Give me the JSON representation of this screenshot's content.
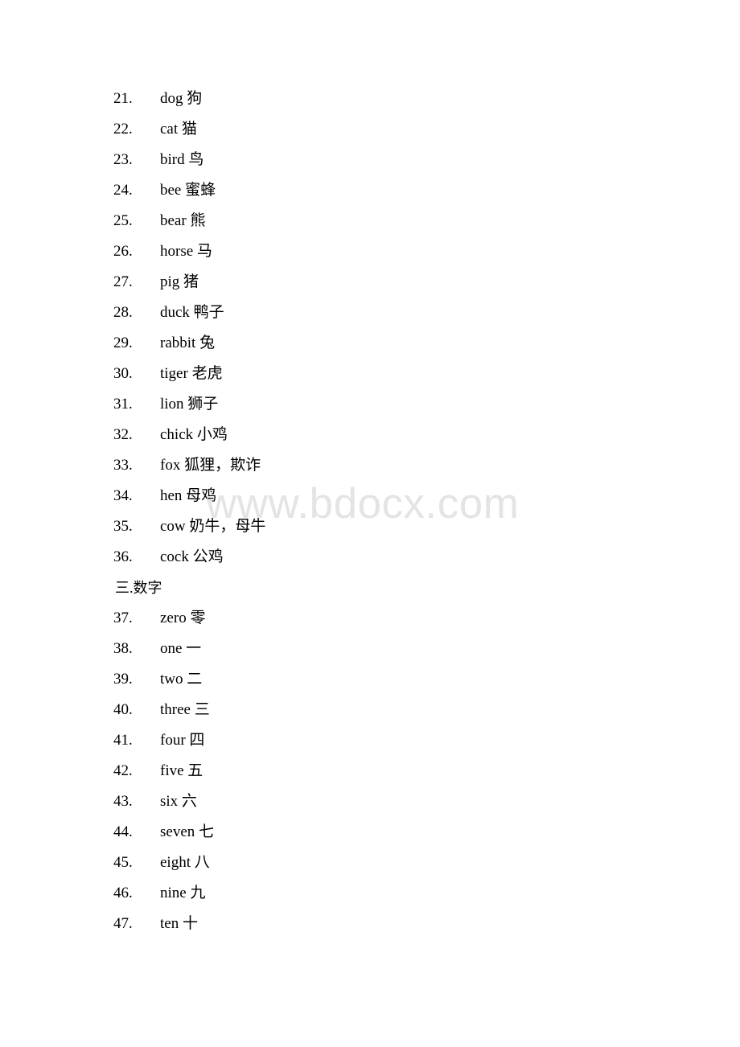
{
  "document": {
    "watermark": "www.bdocx.com",
    "blocks": [
      {
        "type": "item",
        "index": "21.",
        "term": "dog 狗"
      },
      {
        "type": "item",
        "index": "22.",
        "term": "cat 猫"
      },
      {
        "type": "item",
        "index": "23.",
        "term": "bird 鸟"
      },
      {
        "type": "item",
        "index": "24.",
        "term": "bee 蜜蜂"
      },
      {
        "type": "item",
        "index": "25.",
        "term": "bear 熊"
      },
      {
        "type": "item",
        "index": "26.",
        "term": "horse 马"
      },
      {
        "type": "item",
        "index": "27.",
        "term": "pig 猪"
      },
      {
        "type": "item",
        "index": "28.",
        "term": "duck 鸭子"
      },
      {
        "type": "item",
        "index": "29.",
        "term": "rabbit 兔"
      },
      {
        "type": "item",
        "index": "30.",
        "term": "tiger 老虎"
      },
      {
        "type": "item",
        "index": "31.",
        "term": "lion 狮子"
      },
      {
        "type": "item",
        "index": "32.",
        "term": "chick 小鸡"
      },
      {
        "type": "item",
        "index": "33.",
        "term": "fox 狐狸，欺诈"
      },
      {
        "type": "item",
        "index": "34.",
        "term": "hen 母鸡"
      },
      {
        "type": "item",
        "index": "35.",
        "term": "cow 奶牛，母牛"
      },
      {
        "type": "item",
        "index": "36.",
        "term": "cock 公鸡"
      },
      {
        "type": "heading",
        "text": "三.数字"
      },
      {
        "type": "item",
        "index": "37.",
        "term": "zero 零"
      },
      {
        "type": "item",
        "index": "38.",
        "term": "one 一"
      },
      {
        "type": "item",
        "index": "39.",
        "term": "two 二"
      },
      {
        "type": "item",
        "index": "40.",
        "term": "three 三"
      },
      {
        "type": "item",
        "index": "41.",
        "term": "four 四"
      },
      {
        "type": "item",
        "index": "42.",
        "term": "five 五"
      },
      {
        "type": "item",
        "index": "43.",
        "term": "six 六"
      },
      {
        "type": "item",
        "index": "44.",
        "term": "seven 七"
      },
      {
        "type": "item",
        "index": "45.",
        "term": "eight 八"
      },
      {
        "type": "item",
        "index": "46.",
        "term": "nine 九"
      },
      {
        "type": "item",
        "index": "47.",
        "term": "ten 十"
      }
    ]
  }
}
